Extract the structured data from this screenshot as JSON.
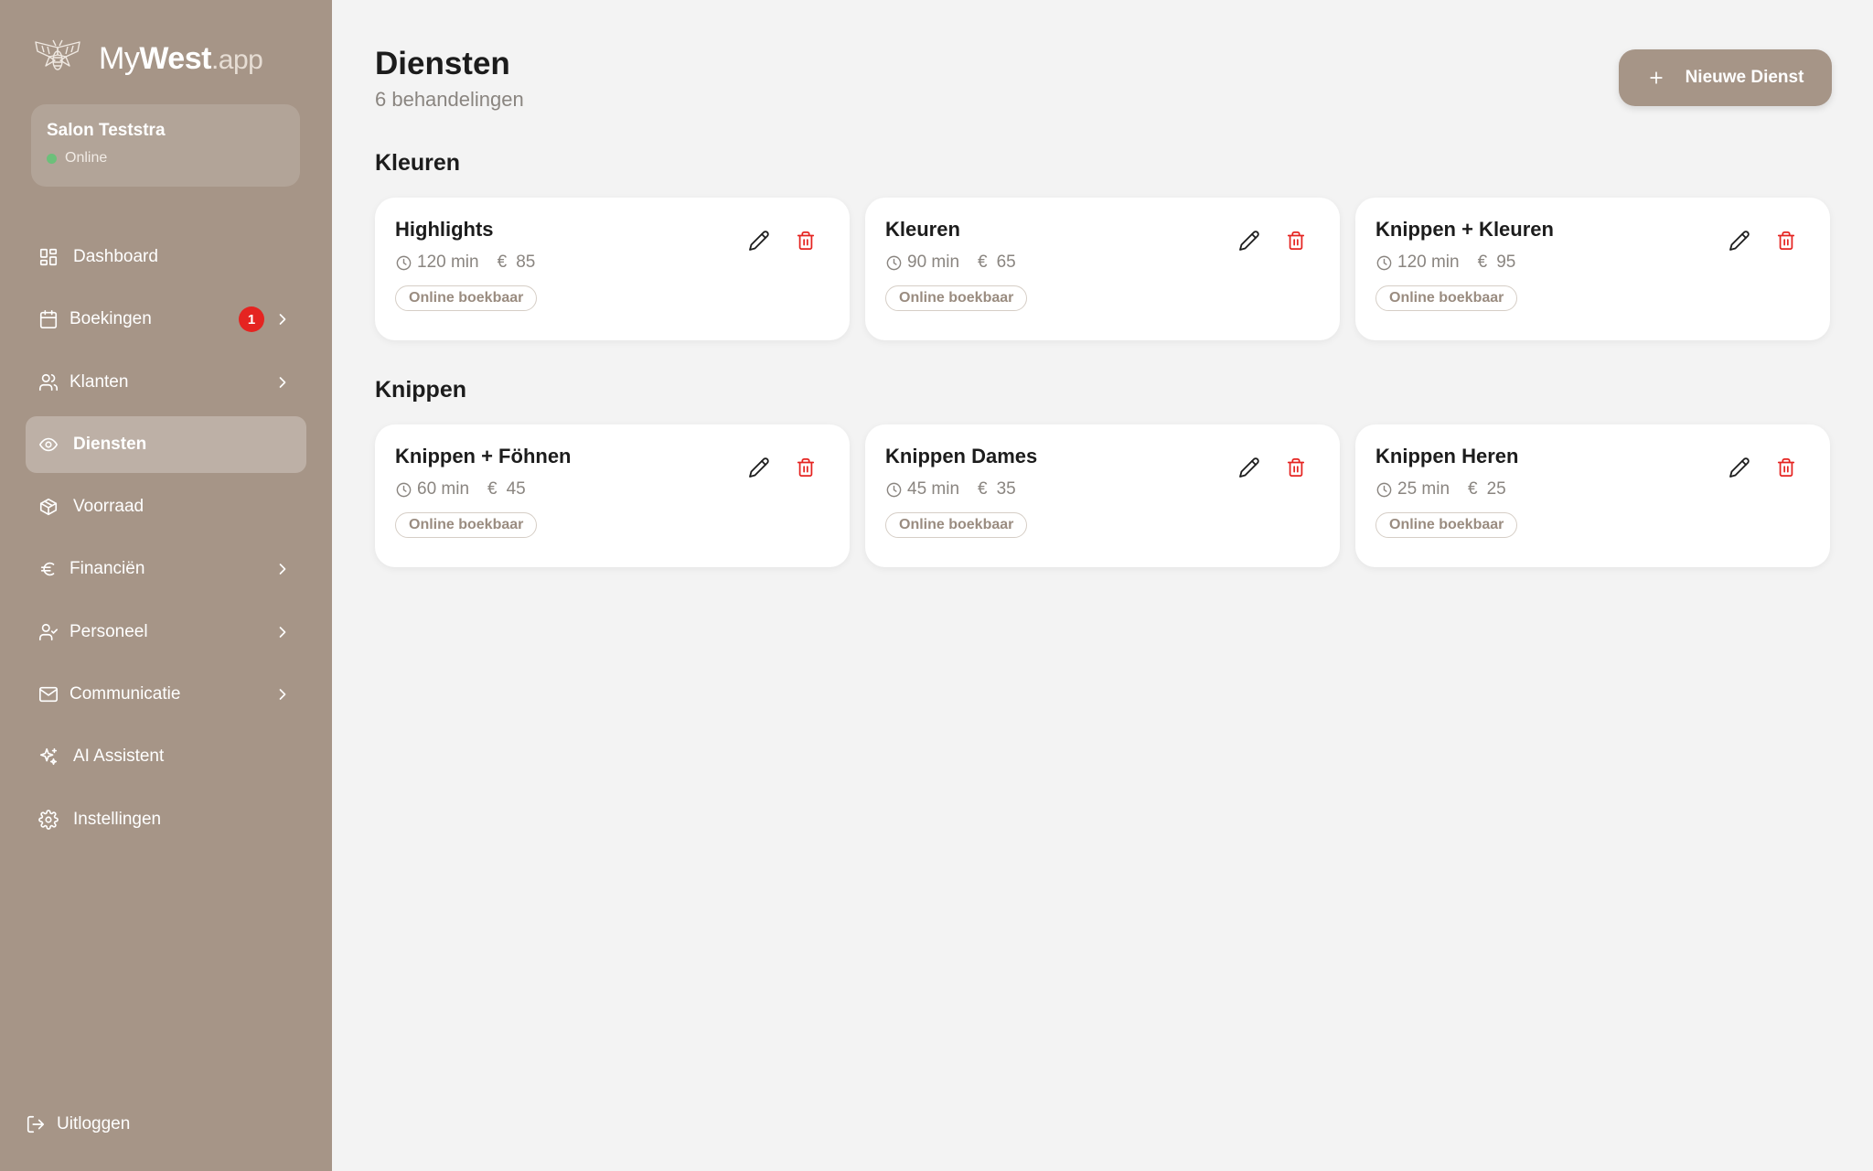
{
  "app": {
    "logo_my": "My",
    "logo_west": "West",
    "logo_app": ".app"
  },
  "salon": {
    "name": "Salon Teststra",
    "status": "Online",
    "status_color": "#6cc07a"
  },
  "colors": {
    "sidebar": "#a69587",
    "accent": "#a69587",
    "danger": "#e52421",
    "background": "#f3f3f3"
  },
  "nav": [
    {
      "label": "Dashboard",
      "icon": "dashboard-icon"
    },
    {
      "label": "Boekingen",
      "icon": "calendar-icon",
      "badge": "1",
      "chevron": true
    },
    {
      "label": "Klanten",
      "icon": "users-icon",
      "chevron": true
    },
    {
      "label": "Diensten",
      "icon": "eye-icon",
      "active": true
    },
    {
      "label": "Voorraad",
      "icon": "box-icon"
    },
    {
      "label": "Financiën",
      "icon": "euro-icon",
      "chevron": true
    },
    {
      "label": "Personeel",
      "icon": "user-check-icon",
      "chevron": true
    },
    {
      "label": "Communicatie",
      "icon": "mail-icon",
      "chevron": true
    },
    {
      "label": "AI Assistent",
      "icon": "sparkles-icon"
    },
    {
      "label": "Instellingen",
      "icon": "gear-icon"
    }
  ],
  "logout": {
    "label": "Uitloggen"
  },
  "page": {
    "title": "Diensten",
    "subtitle": "6 behandelingen",
    "new_button": "Nieuwe Dienst"
  },
  "sections": [
    {
      "title": "Kleuren",
      "services": [
        {
          "name": "Highlights",
          "duration": "120 min",
          "currency": "€",
          "price": "85",
          "tag": "Online boekbaar"
        },
        {
          "name": "Kleuren",
          "duration": "90 min",
          "currency": "€",
          "price": "65",
          "tag": "Online boekbaar"
        },
        {
          "name": "Knippen + Kleuren",
          "duration": "120 min",
          "currency": "€",
          "price": "95",
          "tag": "Online boekbaar"
        }
      ]
    },
    {
      "title": "Knippen",
      "services": [
        {
          "name": "Knippen + Föhnen",
          "duration": "60 min",
          "currency": "€",
          "price": "45",
          "tag": "Online boekbaar"
        },
        {
          "name": "Knippen Dames",
          "duration": "45 min",
          "currency": "€",
          "price": "35",
          "tag": "Online boekbaar"
        },
        {
          "name": "Knippen Heren",
          "duration": "25 min",
          "currency": "€",
          "price": "25",
          "tag": "Online boekbaar"
        }
      ]
    }
  ]
}
